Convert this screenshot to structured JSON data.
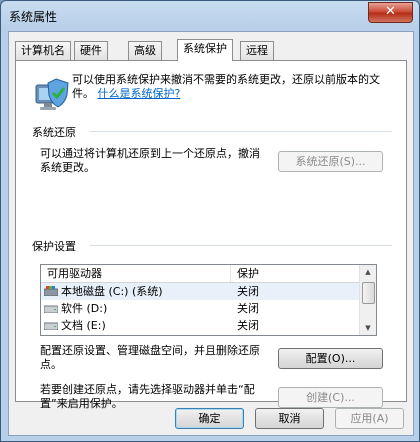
{
  "window": {
    "title": "系统属性",
    "close_glyph": "✕"
  },
  "tabs": [
    {
      "label": "计算机名"
    },
    {
      "label": "硬件"
    },
    {
      "label": "高级"
    },
    {
      "label": "系统保护"
    },
    {
      "label": "远程"
    }
  ],
  "active_tab": "系统保护",
  "intro": {
    "text": "可以使用系统保护来撤消不需要的系统更改，还原以前版本的文件。",
    "link": "什么是系统保护?"
  },
  "restore": {
    "heading": "系统还原",
    "description": "可以通过将计算机还原到上一个还原点，撤消系统更改。",
    "button": "系统还原(S)..."
  },
  "protection": {
    "heading": "保护设置",
    "columns": [
      "可用驱动器",
      "保护"
    ],
    "rows": [
      {
        "name": "本地磁盘 (C:) (系统)",
        "protection": "关闭",
        "icon": "system-drive-icon"
      },
      {
        "name": "软件 (D:)",
        "protection": "关闭",
        "icon": "drive-icon"
      },
      {
        "name": "文档 (E:)",
        "protection": "关闭",
        "icon": "drive-icon"
      }
    ],
    "configure_text": "配置还原设置、管理磁盘空间，并且删除还原点。",
    "configure_button": "配置(O)...",
    "create_text": "若要创建还原点，请先选择驱动器并单击“配置”来启用保护。",
    "create_button": "创建(C)..."
  },
  "footer": {
    "ok": "确定",
    "cancel": "取消",
    "apply": "应用(A)"
  }
}
